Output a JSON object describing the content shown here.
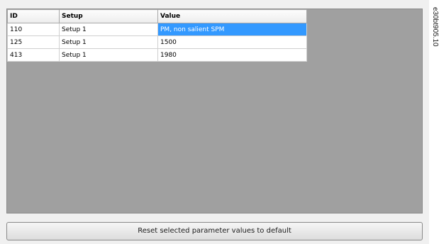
{
  "table": {
    "headers": [
      "ID",
      "Setup",
      "Value"
    ],
    "rows": [
      {
        "id": "110",
        "setup": "Setup 1",
        "value": "PM, non salient SPM"
      },
      {
        "id": "125",
        "setup": "Setup 1",
        "value": "1500"
      },
      {
        "id": "413",
        "setup": "Setup 1",
        "value": "1980"
      }
    ],
    "selected_color": "#3399ff"
  },
  "reset_button_label": "Reset selected parameter values to default",
  "figure_code": "e30bt905.10"
}
